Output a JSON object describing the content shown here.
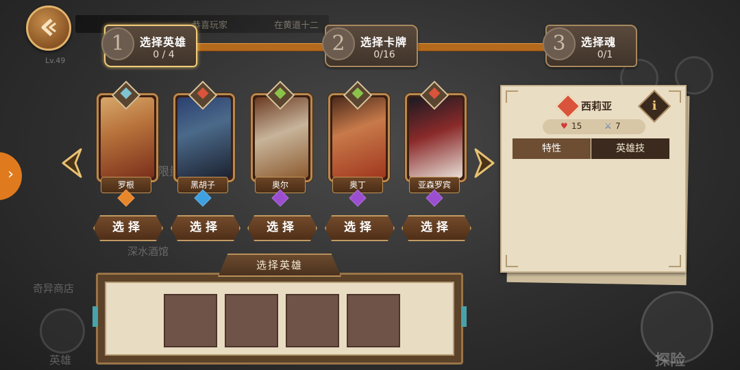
{
  "background": {
    "scroll_text_1": "恭喜玩家",
    "scroll_text_2": "在黄道十二",
    "tavern_label": "深水酒馆",
    "shop_label": "奇异商店",
    "hero_label": "英雄",
    "explore_label": "探险",
    "partial_label": "限量"
  },
  "player": {
    "level": "Lv.49"
  },
  "steps": [
    {
      "num": "1",
      "title": "选择英雄",
      "count": "0 / 4"
    },
    {
      "num": "2",
      "title": "选择卡牌",
      "count": "0/16"
    },
    {
      "num": "3",
      "title": "选择魂",
      "count": "0/1"
    }
  ],
  "heroes": [
    {
      "name": "罗根",
      "class_color": "#7fc2d0",
      "rank_color": "#e8862a"
    },
    {
      "name": "黑胡子",
      "class_color": "#d9543a",
      "rank_color": "#3fa0e0"
    },
    {
      "name": "奥尔",
      "class_color": "#8bc34a",
      "rank_color": "#9b4fd0"
    },
    {
      "name": "奥丁",
      "class_color": "#8bc34a",
      "rank_color": "#9b4fd0"
    },
    {
      "name": "亚森罗宾",
      "class_color": "#d9543a",
      "rank_color": "#9b4fd0"
    }
  ],
  "select_label": "选择",
  "panel": {
    "title": "选择英雄"
  },
  "detail": {
    "name": "西莉亚",
    "hp": "15",
    "attack": "7",
    "tab_traits": "特性",
    "tab_skills": "英雄技",
    "info": "i"
  },
  "colors": {
    "accent": "#b46a1c",
    "orange_tab": "#e07a1e"
  }
}
